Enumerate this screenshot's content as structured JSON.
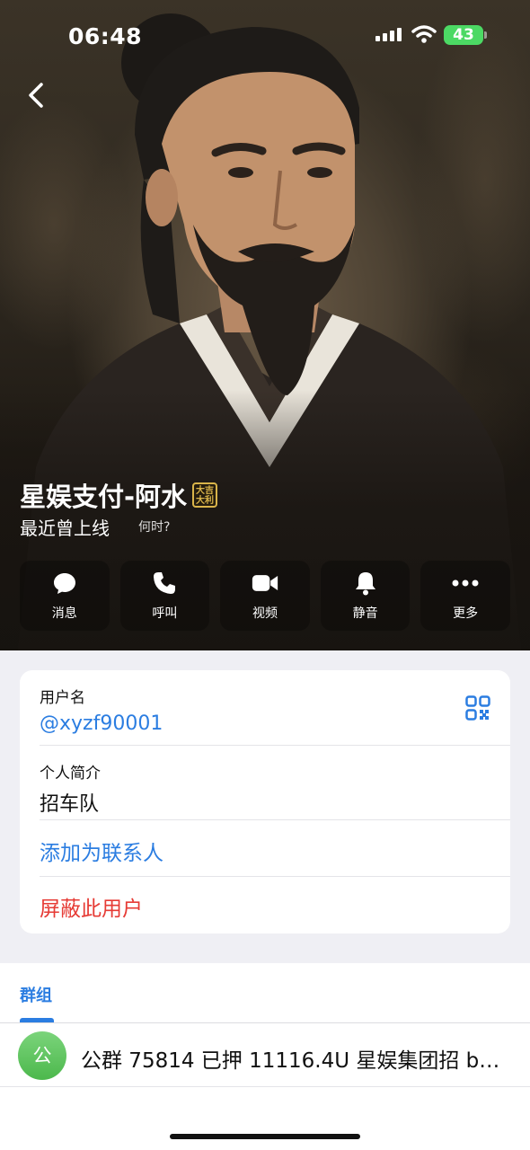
{
  "status_bar": {
    "time": "06:48",
    "battery": "43"
  },
  "profile": {
    "name": "星娱支付-阿水",
    "badge": "大吉大利",
    "presence": "最近曾上线",
    "presence_help": "何时?"
  },
  "actions": [
    {
      "label": "消息",
      "icon": "message-icon"
    },
    {
      "label": "呼叫",
      "icon": "phone-icon"
    },
    {
      "label": "视频",
      "icon": "video-icon"
    },
    {
      "label": "静音",
      "icon": "bell-icon"
    },
    {
      "label": "更多",
      "icon": "more-icon"
    }
  ],
  "info": {
    "username_caption": "用户名",
    "username": "@xyzf90001",
    "bio_caption": "个人简介",
    "bio": "招车队",
    "add_contact": "添加为联系人",
    "block_user": "屏蔽此用户"
  },
  "groups": {
    "tab_label": "群组",
    "items": [
      {
        "avatar_text": "公",
        "title": "公群 75814 已押 11116.4U 星娱集团招 b…"
      }
    ]
  },
  "colors": {
    "accent": "#2b7de1",
    "danger": "#e63b35",
    "avatar_green": "#5bc25b"
  }
}
